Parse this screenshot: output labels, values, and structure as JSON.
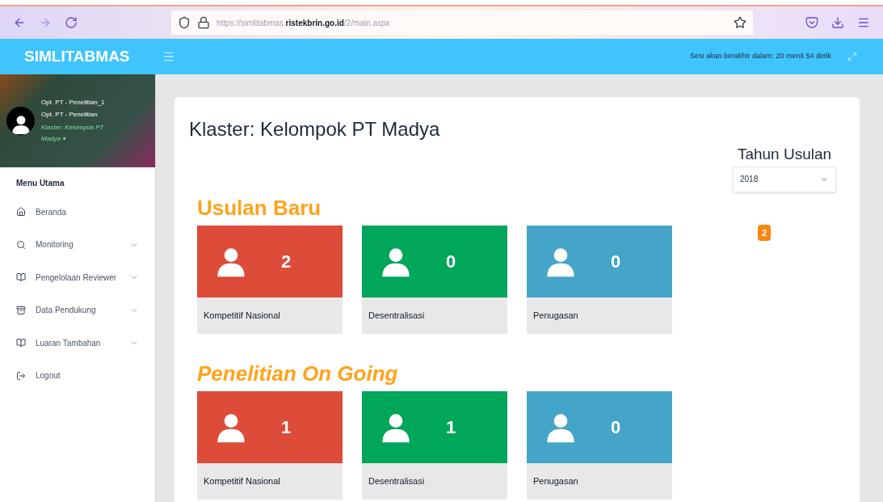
{
  "browser": {
    "url_prefix": "https://simlitabmas.",
    "url_domain": "ristekbrin.go.id",
    "url_suffix": "/2/main.aspx"
  },
  "app": {
    "title": "SIMLITABMAS",
    "session": "Sesi akan berakhir dalam: 20 menit 54 detik"
  },
  "profile": {
    "lines": [
      "Opt. PT - Penelitian_1",
      "Opt. PT - Penelitian"
    ],
    "cluster": "Klaster: Kelompok PT Madya",
    "caret": "▾"
  },
  "menu": {
    "heading": "Menu Utama",
    "items": [
      {
        "label": "Beranda",
        "expandable": false
      },
      {
        "label": "Monitoring",
        "expandable": true
      },
      {
        "label": "Pengelolaan Reviewer",
        "expandable": true
      },
      {
        "label": "Data Pendukung",
        "expandable": true
      },
      {
        "label": "Luaran Tambahan",
        "expandable": true
      },
      {
        "label": "Logout",
        "expandable": false
      }
    ]
  },
  "page": {
    "title": "Klaster: Kelompok PT Madya",
    "year_label": "Tahun Usulan",
    "year": "2018",
    "badge": "2"
  },
  "sections": [
    {
      "title": "Usulan Baru",
      "italic": false,
      "cards": [
        {
          "label": "Kompetitif Nasional",
          "count": "2",
          "color": "#dd4b39"
        },
        {
          "label": "Desentralisasi",
          "count": "0",
          "color": "#00a65a"
        },
        {
          "label": "Penugasan",
          "count": "0",
          "color": "#45a5c8"
        }
      ]
    },
    {
      "title": "Penelitian On Going",
      "italic": true,
      "cards": [
        {
          "label": "Kompetitif Nasional",
          "count": "1",
          "color": "#dd4b39"
        },
        {
          "label": "Desentralisasi",
          "count": "1",
          "color": "#00a65a"
        },
        {
          "label": "Penugasan",
          "count": "0",
          "color": "#45a5c8"
        }
      ]
    }
  ]
}
